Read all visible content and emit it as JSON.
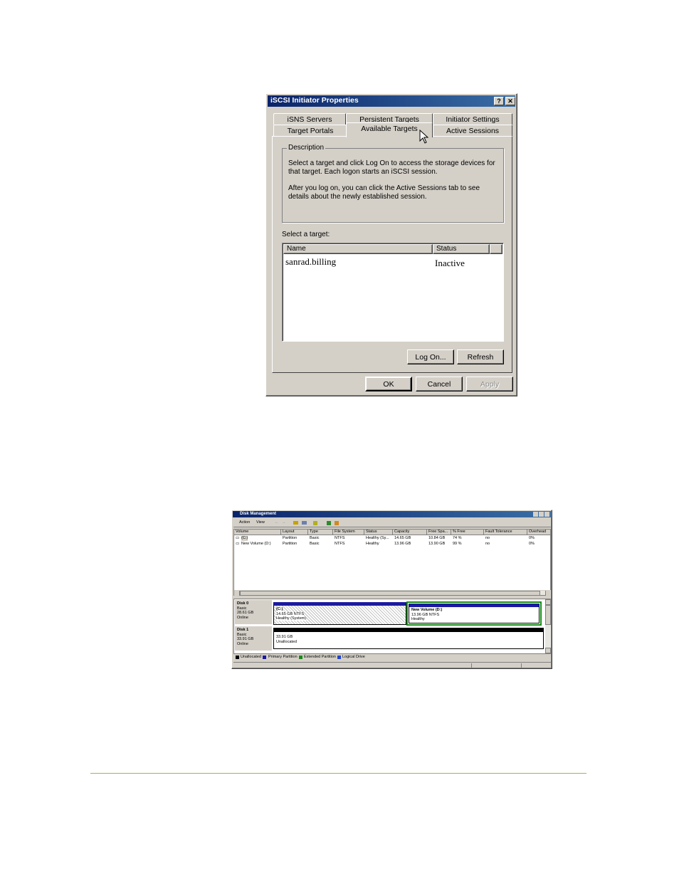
{
  "iscsi_dialog": {
    "title": "iSCSI Initiator Properties",
    "help_glyph": "?",
    "close_glyph": "✕",
    "tabs_top": [
      "iSNS Servers",
      "Persistent Targets",
      "Initiator Settings"
    ],
    "tabs_bottom": [
      "Target Portals",
      "Available Targets",
      "Active Sessions"
    ],
    "description_legend": "Description",
    "description_p1": "Select a target and click Log On to access the storage devices for that target. Each logon starts an iSCSI session.",
    "description_p2": "After you log on, you can click the Active Sessions tab to see details about the newly established session.",
    "select_target_label": "Select a target:",
    "columns": [
      "Name",
      "Status"
    ],
    "targets": [
      {
        "name": "sanrad.billing",
        "status": "Inactive"
      }
    ],
    "log_on_button": "Log On...",
    "refresh_button": "Refresh",
    "ok_button": "OK",
    "cancel_button": "Cancel",
    "apply_button": "Apply"
  },
  "disk_mgmt": {
    "title": "Disk Management",
    "menu": [
      "Action",
      "View"
    ],
    "columns": [
      "Volume",
      "Layout",
      "Type",
      "File System",
      "Status",
      "Capacity",
      "Free Spa...",
      "% Free",
      "Fault Tolerance",
      "Overhead"
    ],
    "rows": [
      {
        "volume": "(C:)",
        "layout": "Partition",
        "type": "Basic",
        "fs": "NTFS",
        "status": "Healthy (Sy...",
        "capacity": "14.65 GB",
        "free": "10.84 GB",
        "pct": "74 %",
        "fault": "no",
        "overhead": "0%"
      },
      {
        "volume": "New Volume (D:)",
        "layout": "Partition",
        "type": "Basic",
        "fs": "NTFS",
        "status": "Healthy",
        "capacity": "13.96 GB",
        "free": "13.90 GB",
        "pct": "99 %",
        "fault": "no",
        "overhead": "0%"
      }
    ],
    "disk0": {
      "name": "Disk 0",
      "type": "Basic",
      "size": "28.61 GB",
      "state": "Online",
      "part1": {
        "label": "(C:)",
        "size": "14.65 GB NTFS",
        "status": "Healthy (System)"
      },
      "part2": {
        "label": "New Volume  (D:)",
        "size": "13.96 GB NTFS",
        "status": "Healthy"
      }
    },
    "disk1": {
      "name": "Disk 1",
      "type": "Basic",
      "size": "33.91 GB",
      "state": "Online",
      "part1": {
        "size": "33.91 GB",
        "status": "Unallocated"
      }
    },
    "legend": [
      "Unallocated",
      "Primary Partition",
      "Extended Partition",
      "Logical Drive"
    ],
    "legend_colors": [
      "#000000",
      "#1a1aa0",
      "#1a8a1a",
      "#2244cc"
    ]
  },
  "colors": {
    "title_bar": "#0a246a",
    "face": "#d4d0c8",
    "rule": "#9ab84a"
  }
}
